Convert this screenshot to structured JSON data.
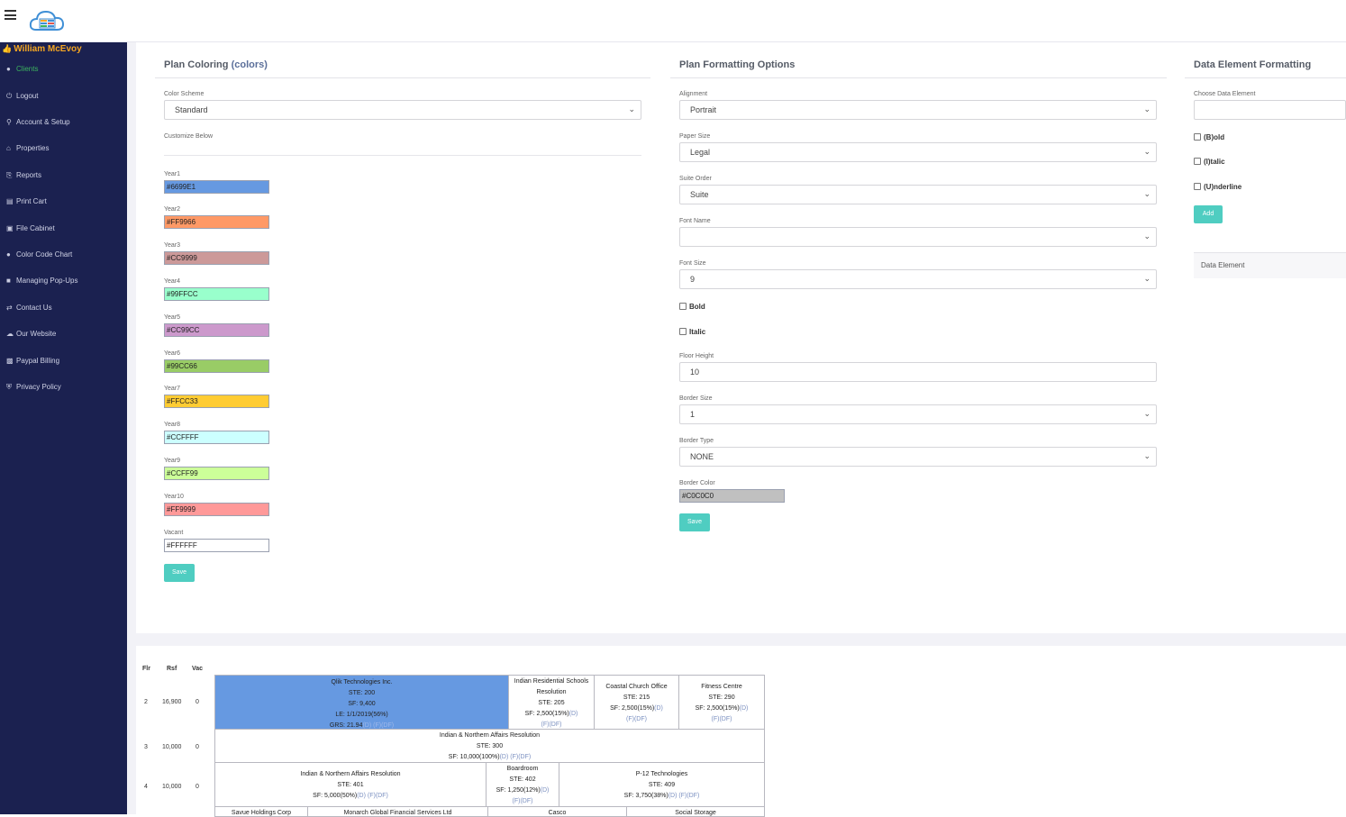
{
  "topbar": {
    "menu_icon": "hamburger-menu-icon",
    "logo_icon": "cloud-spreadsheet-logo-icon"
  },
  "sidebar": {
    "user_name": "William McEvoy",
    "items": [
      {
        "label": "Clients",
        "icon": "users-icon",
        "active": true
      },
      {
        "label": "Logout",
        "icon": "power-icon"
      },
      {
        "label": "Account & Setup",
        "icon": "key-icon"
      },
      {
        "label": "Properties",
        "icon": "home-icon"
      },
      {
        "label": "Reports",
        "icon": "printer-icon"
      },
      {
        "label": "Print Cart",
        "icon": "cart-icon"
      },
      {
        "label": "File Cabinet",
        "icon": "folder-icon"
      },
      {
        "label": "Color Code Chart",
        "icon": "drop-icon"
      },
      {
        "label": "Managing Pop-Ups",
        "icon": "unlock-icon"
      },
      {
        "label": "Contact Us",
        "icon": "exchange-icon"
      },
      {
        "label": "Our Website",
        "icon": "cloud-icon"
      },
      {
        "label": "Paypal Billing",
        "icon": "money-icon"
      },
      {
        "label": "Privacy Policy",
        "icon": "shield-icon"
      }
    ]
  },
  "coloring": {
    "title": "Plan Coloring",
    "title_link": "(colors)",
    "scheme_label": "Color Scheme",
    "scheme_value": "Standard",
    "customize_label": "Customize Below",
    "save_label": "Save",
    "years": [
      {
        "label": "Year1",
        "value": "#6699E1",
        "color": "#6699e1"
      },
      {
        "label": "Year2",
        "value": "#FF9966",
        "color": "#ff9966"
      },
      {
        "label": "Year3",
        "value": "#CC9999",
        "color": "#cc9999"
      },
      {
        "label": "Year4",
        "value": "#99FFCC",
        "color": "#99ffcc"
      },
      {
        "label": "Year5",
        "value": "#CC99CC",
        "color": "#cc99cc"
      },
      {
        "label": "Year6",
        "value": "#99CC66",
        "color": "#99cc66"
      },
      {
        "label": "Year7",
        "value": "#FFCC33",
        "color": "#ffcc33"
      },
      {
        "label": "Year8",
        "value": "#CCFFFF",
        "color": "#ccffff"
      },
      {
        "label": "Year9",
        "value": "#CCFF99",
        "color": "#ccff99"
      },
      {
        "label": "Year10",
        "value": "#FF9999",
        "color": "#ff9999"
      },
      {
        "label": "Vacant",
        "value": "#FFFFFF",
        "color": "#ffffff"
      }
    ]
  },
  "formatting": {
    "title": "Plan Formatting Options",
    "alignment_label": "Alignment",
    "alignment_value": "Portrait",
    "paper_label": "Paper Size",
    "paper_value": "Legal",
    "suite_order_label": "Suite Order",
    "suite_order_value": "Suite",
    "font_name_label": "Font Name",
    "font_name_value": "",
    "font_size_label": "Font Size",
    "font_size_value": "9",
    "bold_label": "Bold",
    "italic_label": "Italic",
    "floor_height_label": "Floor Height",
    "floor_height_value": "10",
    "border_size_label": "Border Size",
    "border_size_value": "1",
    "border_type_label": "Border Type",
    "border_type_value": "NONE",
    "border_color_label": "Border Color",
    "border_color_value": "#C0C0C0",
    "border_color": "#c0c0c0",
    "save_label": "Save"
  },
  "data_element": {
    "title": "Data Element Formatting",
    "choose_label": "Choose Data Element",
    "choose_value": "",
    "bold_label": "(B)old",
    "italic_label": "(I)talic",
    "underline_label": "(U)nderline",
    "add_label": "Add",
    "table_header": "Data Element"
  },
  "stack_plan": {
    "headers": [
      "Flr",
      "Rsf",
      "Vac"
    ],
    "floors": [
      {
        "flr": "2",
        "rsf": "16,900",
        "vac": "0"
      },
      {
        "flr": "3",
        "rsf": "10,000",
        "vac": "0"
      },
      {
        "flr": "4",
        "rsf": "10,000",
        "vac": "0"
      }
    ],
    "links": {
      "d": "(D)",
      "f": "(F)",
      "df": "(DF)"
    },
    "suites": [
      {
        "name": "Qlik Technologies Inc.",
        "ste": "STE: 200",
        "sf": "SF: 9,400",
        "le": "LE: 1/1/2019(56%)",
        "grs": "GRS: 21.94"
      },
      {
        "name": "Indian Residential Schools Resolution",
        "ste": "STE: 205",
        "sf": "SF: 2,500(15%)"
      },
      {
        "name": "Coastal Church Office",
        "ste": "STE: 215",
        "sf": "SF: 2,500(15%)"
      },
      {
        "name": "Fitness Centre",
        "ste": "STE: 290",
        "sf": "SF: 2,500(15%)"
      },
      {
        "name": "Indian & Northern Affairs Resolution",
        "ste": "STE: 300",
        "sf": "SF: 10,000(100%)"
      },
      {
        "name": "Indian & Northern Affairs Resolution",
        "ste": "STE: 401",
        "sf": "SF: 5,000(50%)"
      },
      {
        "name": "Boardroom",
        "ste": "STE: 402",
        "sf": "SF: 1,250(12%)"
      },
      {
        "name": "P-12 Technologies",
        "ste": "STE: 409",
        "sf": "SF: 3,750(38%)"
      },
      {
        "name": "Savue Holdings Corp"
      },
      {
        "name": "Monarch Global Financial Services Ltd"
      },
      {
        "name": "Casco"
      },
      {
        "name": "Social Storage"
      }
    ]
  }
}
